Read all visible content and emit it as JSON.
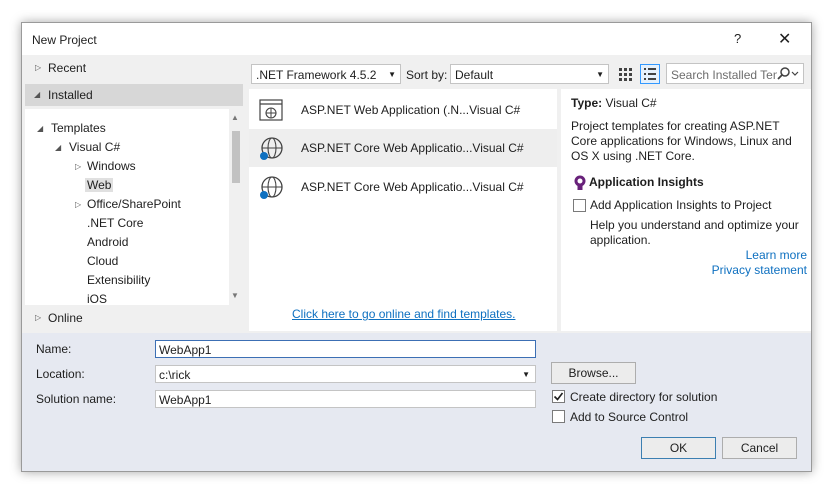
{
  "window": {
    "title": "New Project",
    "help_label": "?",
    "close_label": "✕"
  },
  "left": {
    "recent": "Recent",
    "installed": "Installed",
    "online": "Online",
    "tree": [
      {
        "label": "Templates"
      },
      {
        "label": "Visual C#"
      },
      {
        "label": "Windows"
      },
      {
        "label": "Web"
      },
      {
        "label": "Office/SharePoint"
      },
      {
        "label": ".NET Core"
      },
      {
        "label": "Android"
      },
      {
        "label": "Cloud"
      },
      {
        "label": "Extensibility"
      },
      {
        "label": "iOS"
      }
    ]
  },
  "toolbar": {
    "framework": ".NET Framework 4.5.2",
    "sort_label": "Sort by:",
    "sort_value": "Default",
    "search_placeholder": "Search Installed Templates"
  },
  "templates": [
    {
      "name": "ASP.NET Web Application (.N...",
      "lang": "Visual C#",
      "icon": "globe-page-icon"
    },
    {
      "name": "ASP.NET Core Web Applicatio...",
      "lang": "Visual C#",
      "icon": "globe-core-icon"
    },
    {
      "name": "ASP.NET Core Web Applicatio...",
      "lang": "Visual C#",
      "icon": "globe-core-icon"
    }
  ],
  "online_link": "Click here to go online and find templates.",
  "details": {
    "type_label": "Type:",
    "type_value": "Visual C#",
    "description": "Project templates for creating ASP.NET Core applications for Windows, Linux and OS X using .NET Core.",
    "ai_title": "Application Insights",
    "ai_checkbox": "Add Application Insights to Project",
    "ai_help": "Help you understand and optimize your application.",
    "learn_more": "Learn more",
    "privacy": "Privacy statement"
  },
  "form": {
    "name_label": "Name:",
    "name_value": "WebApp1",
    "location_label": "Location:",
    "location_value": "c:\\rick",
    "solution_label": "Solution name:",
    "solution_value": "WebApp1",
    "browse": "Browse...",
    "create_dir": "Create directory for solution",
    "create_dir_checked": true,
    "source_control": "Add to Source Control",
    "source_control_checked": false,
    "ok": "OK",
    "cancel": "Cancel"
  },
  "colors": {
    "link": "#0e70c0",
    "selected_row": "#d7d7d7",
    "form_bg": "#e6e9f1",
    "accent": "#3399ff"
  }
}
